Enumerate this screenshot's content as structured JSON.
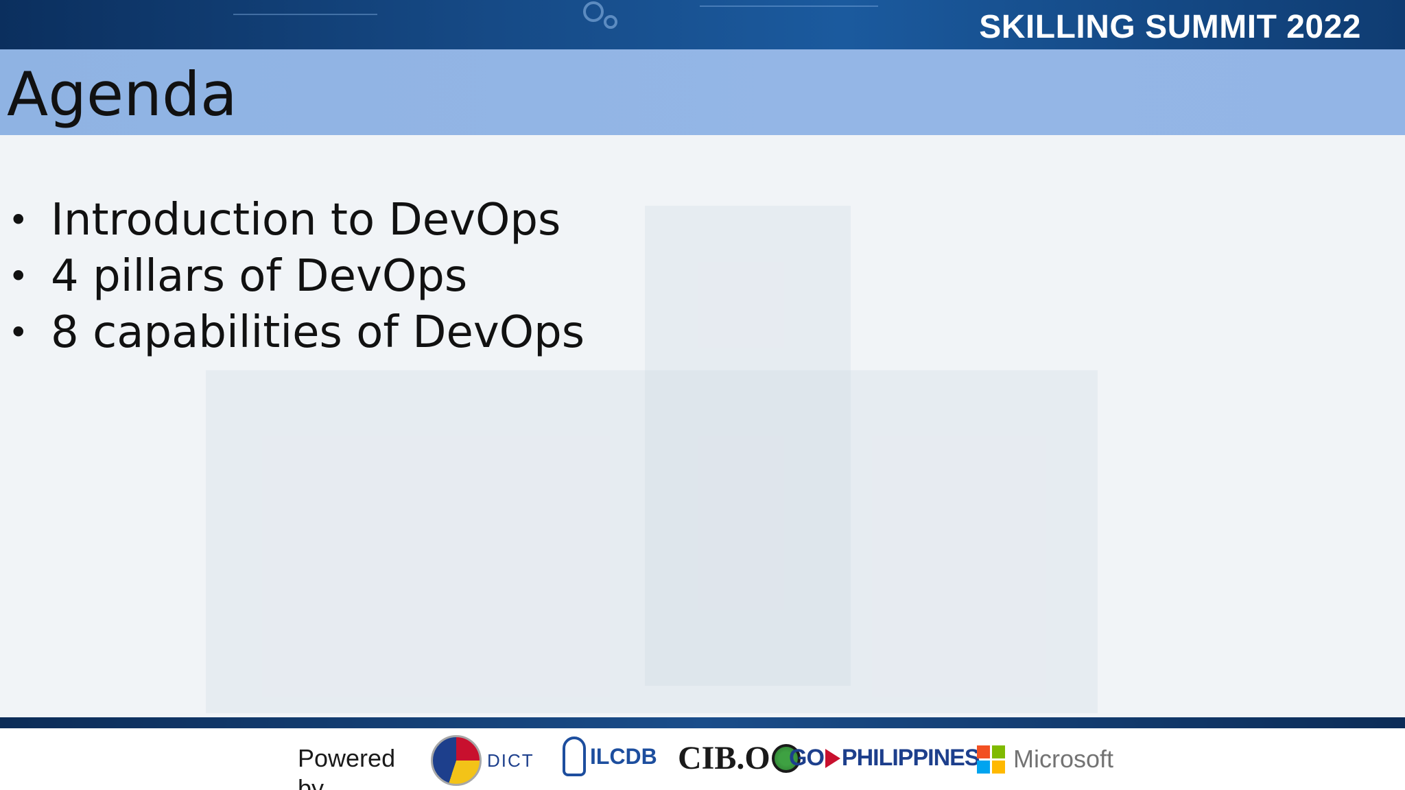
{
  "banner": {
    "title": "SKILLING SUMMIT 2022"
  },
  "slide": {
    "title": "Agenda",
    "items": [
      "Introduction to DevOps",
      "4 pillars of DevOps",
      "8 capabilities of DevOps"
    ]
  },
  "footer": {
    "powered_by": "Powered by",
    "logos": {
      "dict": "DICT",
      "ilcdb": "ILCDB",
      "cibo": "CIB.O",
      "gophl_prefix": "GO",
      "gophl_suffix": "PHILIPPINES",
      "ms": "Microsoft"
    }
  },
  "colors": {
    "banner_bg": "#164a86",
    "title_bar_bg": "#93b5e6",
    "slide_bg": "#f1f4f7",
    "ms_red": "#f25022",
    "ms_green": "#7fba00",
    "ms_blue": "#00a4ef",
    "ms_yellow": "#ffb900"
  }
}
